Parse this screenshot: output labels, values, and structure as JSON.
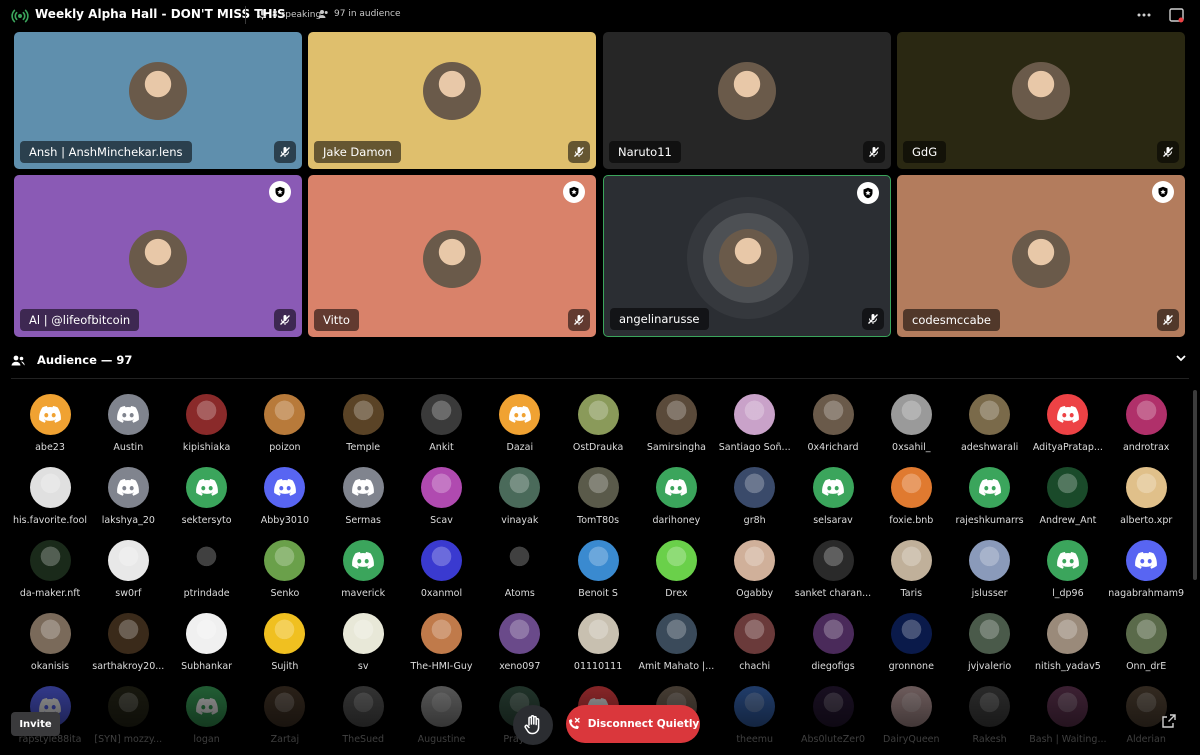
{
  "header": {
    "title": "Weekly Alpha Hall - DON'T MISS THIS",
    "speaking": "8 speaking",
    "audience_count": "97 in audience"
  },
  "speakers": [
    {
      "name": "Ansh | AnshMinchekar.lens",
      "bg": "#5f8fad",
      "moderator": false,
      "active": false
    },
    {
      "name": "Jake Damon",
      "bg": "#dfbf6d",
      "moderator": false,
      "active": false
    },
    {
      "name": "Naruto11",
      "bg": "#262626",
      "moderator": false,
      "active": false
    },
    {
      "name": "GdG",
      "bg": "#2a2812",
      "moderator": false,
      "active": false
    },
    {
      "name": "Al | @lifeofbitcoin",
      "bg": "#8a5ab5",
      "moderator": true,
      "active": false
    },
    {
      "name": "Vitto",
      "bg": "#d9826a",
      "moderator": true,
      "active": false
    },
    {
      "name": "angelinarusse",
      "bg": "#2b2e33",
      "moderator": true,
      "active": true
    },
    {
      "name": "codesmccabe",
      "bg": "#b37c5d",
      "moderator": true,
      "active": false
    }
  ],
  "audience": {
    "label": "Audience — 97",
    "members": [
      {
        "name": "abe23",
        "color": "#f0a232",
        "icon": "discord-icon"
      },
      {
        "name": "Austin",
        "color": "#80848e",
        "icon": "discord-icon"
      },
      {
        "name": "kipishiaka",
        "color": "#8a2a2a",
        "icon": "photo-avatar"
      },
      {
        "name": "poizon",
        "color": "#b87a3a",
        "icon": "photo-avatar"
      },
      {
        "name": "Temple",
        "color": "#5a4326",
        "icon": "photo-avatar"
      },
      {
        "name": "Ankit",
        "color": "#3a3a3a",
        "icon": "photo-avatar"
      },
      {
        "name": "Dazai",
        "color": "#f0a232",
        "icon": "discord-icon"
      },
      {
        "name": "OstDrauka",
        "color": "#8a9a5a",
        "icon": "photo-avatar"
      },
      {
        "name": "Samirsingha",
        "color": "#5a4a3a",
        "icon": "photo-avatar"
      },
      {
        "name": "Santiago Soñ...",
        "color": "#c9a2c9",
        "icon": "photo-avatar"
      },
      {
        "name": "0x4richard",
        "color": "#6a5a4a",
        "icon": "photo-avatar"
      },
      {
        "name": "0xsahil_",
        "color": "#9a9a9a",
        "icon": "photo-avatar"
      },
      {
        "name": "adeshwarali",
        "color": "#7a6a4a",
        "icon": "photo-avatar"
      },
      {
        "name": "AdityaPratap...",
        "color": "#ed4245",
        "icon": "discord-icon"
      },
      {
        "name": "androtrax",
        "color": "#b0306a",
        "icon": "photo-avatar"
      },
      {
        "name": "his.favorite.fool",
        "color": "#e0e0e0",
        "icon": "photo-avatar"
      },
      {
        "name": "lakshya_20",
        "color": "#80848e",
        "icon": "discord-icon"
      },
      {
        "name": "sektersyto",
        "color": "#3ba55c",
        "icon": "discord-icon"
      },
      {
        "name": "Abby3010",
        "color": "#5865f2",
        "icon": "discord-icon"
      },
      {
        "name": "Sermas",
        "color": "#80848e",
        "icon": "discord-icon"
      },
      {
        "name": "Scav",
        "color": "#b04ab0",
        "icon": "photo-avatar"
      },
      {
        "name": "vinayak",
        "color": "#4a6a5a",
        "icon": "photo-avatar"
      },
      {
        "name": "TomT80s",
        "color": "#5a5a4a",
        "icon": "photo-avatar"
      },
      {
        "name": "darihoney",
        "color": "#3ba55c",
        "icon": "discord-icon"
      },
      {
        "name": "gr8h",
        "color": "#3a4a6a",
        "icon": "photo-avatar"
      },
      {
        "name": "selsarav",
        "color": "#3ba55c",
        "icon": "discord-icon"
      },
      {
        "name": "foxie.bnb",
        "color": "#e07a30",
        "icon": "photo-avatar"
      },
      {
        "name": "rajeshkumarrs",
        "color": "#3ba55c",
        "icon": "discord-icon"
      },
      {
        "name": "Andrew_Ant",
        "color": "#1a4a2a",
        "icon": "photo-avatar"
      },
      {
        "name": "alberto.xpr",
        "color": "#e0c08a",
        "icon": "photo-avatar"
      },
      {
        "name": "da-maker.nft",
        "color": "#1a2a1a",
        "icon": "photo-avatar"
      },
      {
        "name": "sw0rf",
        "color": "#e8e8e8",
        "icon": "photo-avatar"
      },
      {
        "name": "ptrindade",
        "color": "#000000",
        "icon": "photo-avatar"
      },
      {
        "name": "Senko",
        "color": "#6aa04a",
        "icon": "photo-avatar"
      },
      {
        "name": "maverick",
        "color": "#3ba55c",
        "icon": "discord-icon"
      },
      {
        "name": "0xanmol",
        "color": "#3a3ad0",
        "icon": "photo-avatar"
      },
      {
        "name": "Atoms",
        "color": "#000000",
        "icon": "photo-avatar"
      },
      {
        "name": "Benoit S",
        "color": "#3a8ad0",
        "icon": "photo-avatar"
      },
      {
        "name": "Drex",
        "color": "#6ad04a",
        "icon": "photo-avatar"
      },
      {
        "name": "Ogabby",
        "color": "#d0b09a",
        "icon": "photo-avatar"
      },
      {
        "name": "sanket charan...",
        "color": "#2a2a2a",
        "icon": "photo-avatar"
      },
      {
        "name": "Taris",
        "color": "#c0b09a",
        "icon": "photo-avatar"
      },
      {
        "name": "jslusser",
        "color": "#8a9aba",
        "icon": "photo-avatar"
      },
      {
        "name": "l_dp96",
        "color": "#3ba55c",
        "icon": "discord-icon"
      },
      {
        "name": "nagabrahmam9",
        "color": "#5865f2",
        "icon": "discord-icon"
      },
      {
        "name": "okanisis",
        "color": "#7a6a5a",
        "icon": "photo-avatar"
      },
      {
        "name": "sarthakroy20...",
        "color": "#3a2a1a",
        "icon": "photo-avatar"
      },
      {
        "name": "Subhankar",
        "color": "#f0f0f0",
        "icon": "photo-avatar"
      },
      {
        "name": "Sujith",
        "color": "#f0c020",
        "icon": "photo-avatar"
      },
      {
        "name": "sv",
        "color": "#e8e8d8",
        "icon": "photo-avatar"
      },
      {
        "name": "The-HMI-Guy",
        "color": "#c07a4a",
        "icon": "photo-avatar"
      },
      {
        "name": "xeno097",
        "color": "#6a4a8a",
        "icon": "photo-avatar"
      },
      {
        "name": "01110111",
        "color": "#c8c0b0",
        "icon": "photo-avatar"
      },
      {
        "name": "Amit Mahato |...",
        "color": "#3a4a5a",
        "icon": "photo-avatar"
      },
      {
        "name": "chachi",
        "color": "#6a3a3a",
        "icon": "photo-avatar"
      },
      {
        "name": "diegofigs",
        "color": "#4a2a5a",
        "icon": "photo-avatar"
      },
      {
        "name": "gronnone",
        "color": "#0a1a4a",
        "icon": "photo-avatar"
      },
      {
        "name": "jvjvalerio",
        "color": "#4a5a4a",
        "icon": "photo-avatar"
      },
      {
        "name": "nitish_yadav5",
        "color": "#9a8a7a",
        "icon": "photo-avatar"
      },
      {
        "name": "Onn_drE",
        "color": "#5a6a4a",
        "icon": "photo-avatar"
      },
      {
        "name": "rapstyle88ita",
        "color": "#5865f2",
        "icon": "discord-icon"
      },
      {
        "name": "[SYN] mozzy...",
        "color": "#2a2a1a",
        "icon": "photo-avatar"
      },
      {
        "name": "logan",
        "color": "#3ba55c",
        "icon": "discord-icon"
      },
      {
        "name": "Zartaj",
        "color": "#4a3a2a",
        "icon": "photo-avatar"
      },
      {
        "name": "TheSued",
        "color": "#5a5a5a",
        "icon": "photo-avatar"
      },
      {
        "name": "Augustine",
        "color": "#9a9a9a",
        "icon": "photo-avatar"
      },
      {
        "name": "Prayag",
        "color": "#3a5a4a",
        "icon": "photo-avatar"
      },
      {
        "name": "",
        "color": "#ed4245",
        "icon": "discord-icon"
      },
      {
        "name": "",
        "color": "#7a6a5a",
        "icon": "photo-avatar"
      },
      {
        "name": "theemu",
        "color": "#3a6aba",
        "icon": "photo-avatar"
      },
      {
        "name": "Abs0luteZer0",
        "color": "#2a1a3a",
        "icon": "photo-avatar"
      },
      {
        "name": "DairyQueen",
        "color": "#c0a0a0",
        "icon": "photo-avatar"
      },
      {
        "name": "Rakesh",
        "color": "#4a4a4a",
        "icon": "photo-avatar"
      },
      {
        "name": "Bash | Waiting...",
        "color": "#6a3a5a",
        "icon": "photo-avatar"
      },
      {
        "name": "Alderian",
        "color": "#5a4a3a",
        "icon": "photo-avatar"
      }
    ]
  },
  "controls": {
    "invite_label": "Invite",
    "disconnect_label": "Disconnect Quietly"
  }
}
